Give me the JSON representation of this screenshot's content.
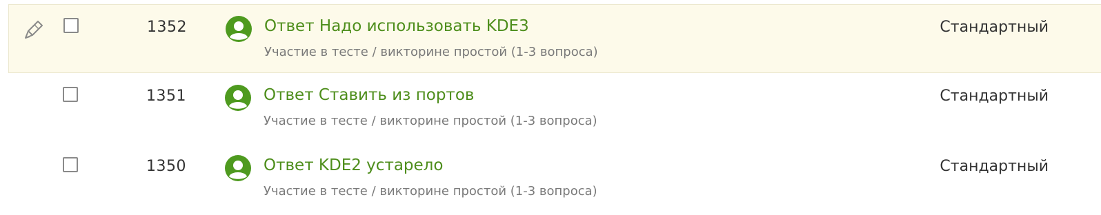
{
  "rows": [
    {
      "id": "1352",
      "title": "Ответ Надо использовать KDE3",
      "subtitle": "Участие в тесте / викторине простой (1-3 вопроса)",
      "type": "Стандартный",
      "highlighted": true,
      "checked": false,
      "icon": "pencil-icon"
    },
    {
      "id": "1351",
      "title": "Ответ Ставить из портов",
      "subtitle": "Участие в тесте / викторине простой (1-3 вопроса)",
      "type": "Стандартный",
      "highlighted": false,
      "checked": false
    },
    {
      "id": "1350",
      "title": "Ответ KDE2 устарело",
      "subtitle": "Участие в тесте / викторине простой (1-3 вопроса)",
      "type": "Стандартный",
      "highlighted": false,
      "checked": false
    }
  ],
  "colors": {
    "accent_green": "#4e8e1c",
    "highlight_row": "#fdfaea",
    "avatar_green": "#4e9a1f"
  }
}
